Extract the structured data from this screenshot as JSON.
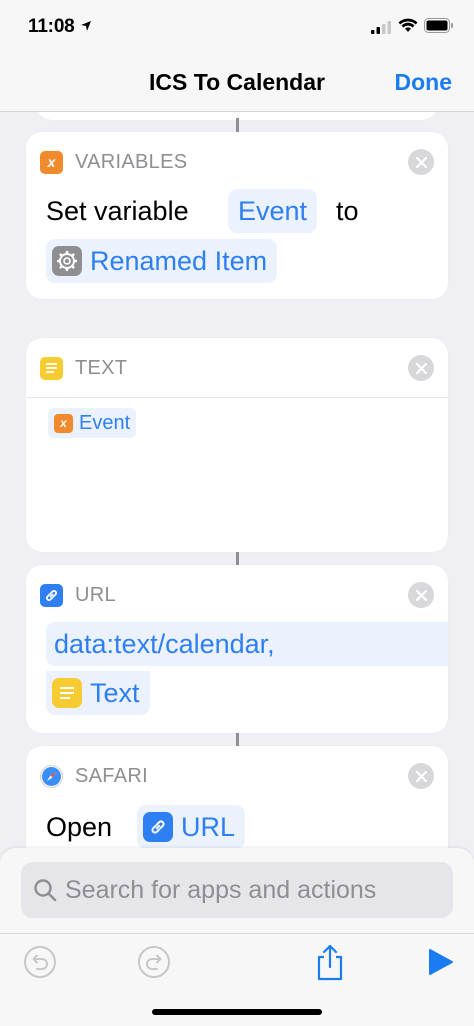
{
  "status": {
    "time": "11:08"
  },
  "nav": {
    "title": "ICS To Calendar",
    "done_label": "Done"
  },
  "actions": [
    {
      "category": "VARIABLES",
      "category_color": "#f08a2c",
      "text_before": "Set variable",
      "variable_token": "Event",
      "text_middle": "to",
      "value_token": "Renamed Item",
      "value_icon": "gear-icon"
    },
    {
      "category": "TEXT",
      "category_color": "#f7cc32",
      "content_token": "Event",
      "content_token_icon": "variable-icon"
    },
    {
      "category": "URL",
      "category_color": "#2d7ff2",
      "url_text": "data:text/calendar,",
      "url_token": "Text",
      "url_token_icon": "text-icon"
    },
    {
      "category": "SAFARI",
      "category_color": "#2d7ff2",
      "text_before": "Open",
      "url_token": "URL",
      "url_token_icon": "link-icon"
    }
  ],
  "search": {
    "placeholder": "Search for apps and actions"
  },
  "toolbar": {
    "undo_icon": "undo-icon",
    "redo_icon": "redo-icon",
    "share_icon": "share-icon",
    "play_icon": "play-icon"
  },
  "colors": {
    "accent": "#1b7cf2",
    "background": "#efeff4",
    "card": "#ffffff"
  }
}
